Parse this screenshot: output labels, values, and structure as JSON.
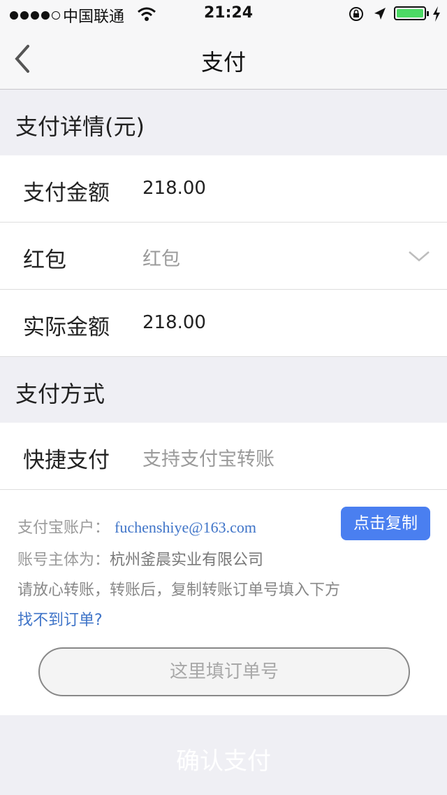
{
  "status_bar": {
    "carrier": "中国联通",
    "time": "21:24"
  },
  "nav": {
    "title": "支付"
  },
  "payment_details": {
    "heading": "支付详情(元)",
    "rows": [
      {
        "label": "支付金额",
        "value": "218.00"
      },
      {
        "label": "红包",
        "value": "红包"
      },
      {
        "label": "实际金额",
        "value": "218.00"
      }
    ]
  },
  "payment_method": {
    "heading": "支付方式",
    "row": {
      "label": "快捷支付",
      "value": "支持支付宝转账"
    }
  },
  "alipay_info": {
    "account_label": "支付宝账户：",
    "account_email": "fuchenshiye@163.com",
    "copy_label": "点击复制",
    "entity_label": "账号主体为：",
    "entity_name": "杭州釜晨实业有限公司",
    "instruction": "请放心转账，转账后，复制转账订单号填入下方",
    "not_found_link": "找不到订单?",
    "order_placeholder": "这里填订单号"
  },
  "confirm_label": "确认支付",
  "colors": {
    "accent": "#4a7ff0",
    "link": "#3f74c8",
    "battery": "#4cd964"
  }
}
